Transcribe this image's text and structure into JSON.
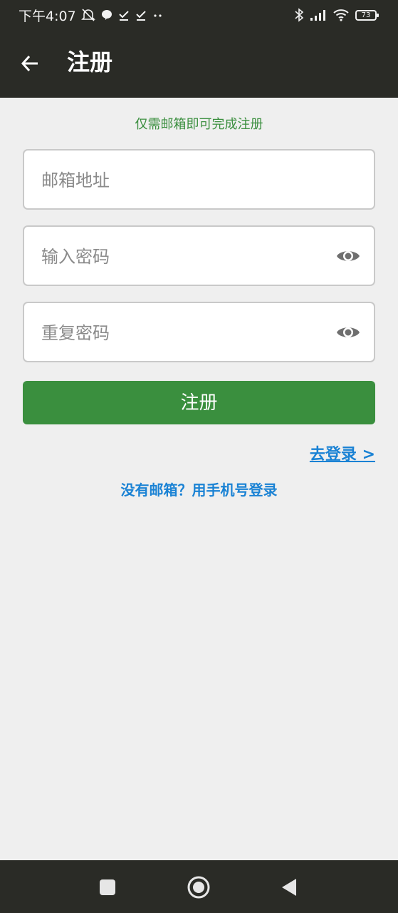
{
  "status_bar": {
    "time": "下午4:07",
    "battery": "73"
  },
  "app_bar": {
    "title": "注册"
  },
  "form": {
    "hint": "仅需邮箱即可完成注册",
    "email_placeholder": "邮箱地址",
    "password_placeholder": "输入密码",
    "repeat_password_placeholder": "重复密码",
    "submit_label": "注册"
  },
  "links": {
    "login": "去登录 >",
    "phone_login": "没有邮箱？用手机号登录"
  },
  "colors": {
    "header_bg": "#2a2b26",
    "accent_green": "#3a8f3e",
    "link_blue": "#1a82d4",
    "page_bg": "#efefef"
  }
}
